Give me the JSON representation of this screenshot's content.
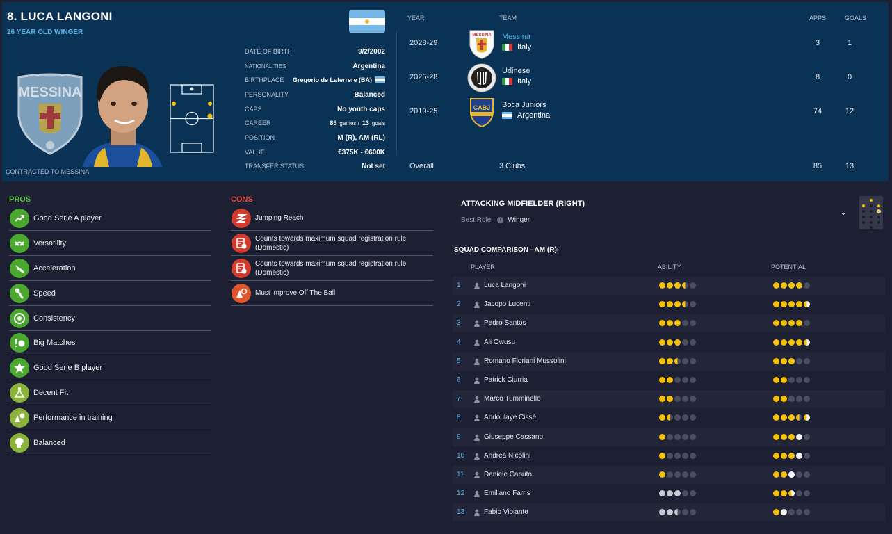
{
  "header": {
    "player_name": "8. LUCA LANGONI",
    "subtitle": "26 YEAR OLD WINGER",
    "contract_note": "CONTRACTED TO MESSINA",
    "crest_text": "MESSINA",
    "details": [
      {
        "label": "DATE OF BIRTH",
        "value": "9/2/2002"
      },
      {
        "label": "NATIONALITIES",
        "value": "Argentina"
      },
      {
        "label": "BIRTHPLACE",
        "value": "Gregorio de Laferrere (BA)"
      },
      {
        "label": "PERSONALITY",
        "value": "Balanced"
      },
      {
        "label": "CAPS",
        "value": "No youth caps"
      },
      {
        "label": "CAREER",
        "games": "85",
        "games_unit": "games /",
        "goals": "13",
        "goals_unit": "goals"
      },
      {
        "label": "POSITION",
        "value": "M (R), AM (RL)"
      },
      {
        "label": "VALUE",
        "value": "€375K - €600K"
      },
      {
        "label": "TRANSFER STATUS",
        "value": "Not set"
      }
    ]
  },
  "history": {
    "columns": {
      "year": "YEAR",
      "team": "TEAM",
      "apps": "APPS",
      "goals": "GOALS"
    },
    "rows": [
      {
        "year": "2028-29",
        "team": "Messina",
        "nation": "Italy",
        "apps": "3",
        "goals": "1",
        "logo": "messina-logo"
      },
      {
        "year": "2025-28",
        "team": "Udinese",
        "nation": "Italy",
        "apps": "8",
        "goals": "0",
        "logo": "udinese-logo"
      },
      {
        "year": "2019-25",
        "team": "Boca Juniors",
        "nation": "Argentina",
        "apps": "74",
        "goals": "12",
        "logo": "boca-juniors-logo"
      }
    ],
    "overall": {
      "label": "Overall",
      "clubs": "3 Clubs",
      "apps": "85",
      "goals": "13"
    },
    "logo_texts": {
      "messina": "MESSINA",
      "boca": "CABJ"
    }
  },
  "pros": {
    "title": "PROS",
    "items": [
      "Good Serie A player",
      "Versatility",
      "Acceleration",
      "Speed",
      "Consistency",
      "Big Matches",
      "Good Serie B player",
      "Decent Fit",
      "Performance in training",
      "Balanced"
    ]
  },
  "cons": {
    "title": "CONS",
    "items": [
      {
        "line1": "Jumping Reach",
        "line2": ""
      },
      {
        "line1": "Counts towards maximum squad registration rule",
        "line2": "(Domestic)"
      },
      {
        "line1": "Counts towards maximum squad registration rule",
        "line2": "(Domestic)"
      },
      {
        "line1": "Must improve Off The Ball",
        "line2": ""
      }
    ]
  },
  "role": {
    "title": "ATTACKING MIDFIELDER (RIGHT)",
    "best_role_label": "Best Role",
    "best_role_info": "i",
    "best_role_value": "Winger",
    "chevron": "⌄"
  },
  "squad": {
    "title": "SQUAD COMPARISON - AM (R)›",
    "columns": {
      "player": "PLAYER",
      "ability": "ABILITY",
      "potential": "POTENTIAL"
    },
    "rows": [
      {
        "num": "1",
        "name": "Luca Langoni",
        "ability": 3.5,
        "potential": 4
      },
      {
        "num": "2",
        "name": "Jacopo Lucenti",
        "ability": 3.5,
        "potential": 4.5
      },
      {
        "num": "3",
        "name": "Pedro Santos",
        "ability": 3,
        "potential": 4
      },
      {
        "num": "4",
        "name": "Ali Owusu",
        "ability": 3,
        "potential": 4.5
      },
      {
        "num": "5",
        "name": "Romano Floriani Mussolini",
        "ability": 2.5,
        "potential": 3
      },
      {
        "num": "6",
        "name": "Patrick Ciurria",
        "ability": 2,
        "potential": 2
      },
      {
        "num": "7",
        "name": "Marco Tumminello",
        "ability": 2,
        "potential": 2
      },
      {
        "num": "8",
        "name": "Abdoulaye Cissé",
        "ability": 1.5,
        "potential": 3.5
      },
      {
        "num": "9",
        "name": "Giuseppe Cassano",
        "ability": 1,
        "potential": 4
      },
      {
        "num": "10",
        "name": "Andrea Nicolini",
        "ability": 1,
        "potential": 4
      },
      {
        "num": "11",
        "name": "Daniele Caputo",
        "ability": 1,
        "potential": 3
      },
      {
        "num": "12",
        "name": "Emiliano Farris",
        "ability": 3,
        "potential": 3
      },
      {
        "num": "13",
        "name": "Fabio Violante",
        "ability": 2.5,
        "potential": 2
      }
    ]
  },
  "colors": {
    "pros": "#58c53a",
    "cons": "#e34a3a",
    "star": "#f4c20d",
    "accent": "#4fb0e6"
  }
}
